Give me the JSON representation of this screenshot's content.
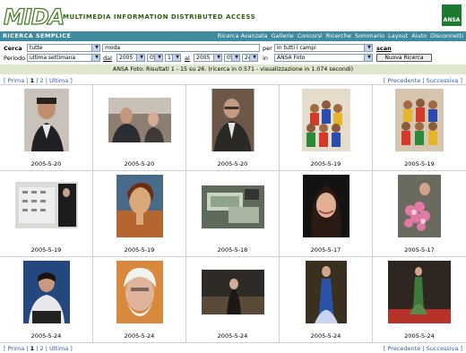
{
  "header": {
    "logo_text": "MIDA",
    "tagline": "MULTIMEDIA INFORMATION DISTRIBUTED ACCESS",
    "brand_badge": "ANSA"
  },
  "nav": {
    "title": "RICERCA SEMPLICE",
    "links": [
      "Ricerca Avanzata",
      "Gallerie",
      "Concorsi",
      "Ricerche",
      "Sommario",
      "Layout",
      "Aiuto",
      "Disconnetti"
    ]
  },
  "form": {
    "cerca_label": "Cerca",
    "periodo_label": "Periodo",
    "mode_select": "tutte",
    "query_value": "moda",
    "per_label": "per",
    "field_select": "In tutti i campi",
    "scan_link": "scan",
    "period_select": "ultima settimana",
    "dal_label": "dal",
    "from_year": "2005",
    "from_month": "05",
    "from_day": "17",
    "al_label": "al",
    "to_year": "2005",
    "to_month": "05",
    "to_day": "24",
    "in_label": "in",
    "archive_select": "ANSA Foto",
    "new_search_button": "Nuova Ricerca"
  },
  "result_text": "ANSA Foto: Risultati 1 - 15 su 26. (ricerca in 0.571 - visualizzazione in 1.074 secondi)",
  "pager": {
    "open": "[",
    "first": "Prima",
    "sep": "|",
    "page1": "1",
    "page2": "2",
    "last": "Ultima",
    "close": "]",
    "prev": "Precedente",
    "next": "Successiva"
  },
  "photos": [
    {
      "date": "2005-5-20",
      "bg": "#c8b5a6"
    },
    {
      "date": "2005-5-20",
      "bg": "#6d5a4c"
    },
    {
      "date": "2005-5-20",
      "bg": "#5a4a3e"
    },
    {
      "date": "2005-5-19",
      "bg": "#d9a46a"
    },
    {
      "date": "2005-5-19",
      "bg": "#c47a4d"
    },
    {
      "date": "2005-5-19",
      "bg": "#d6d3cf"
    },
    {
      "date": "2005-5-19",
      "bg": "#9a7a52"
    },
    {
      "date": "2005-5-18",
      "bg": "#7e8a78"
    },
    {
      "date": "2005-5-17",
      "bg": "#1e1a1a"
    },
    {
      "date": "2005-5-17",
      "bg": "#b8879a"
    },
    {
      "date": "2005-5-24",
      "bg": "#2a4a80"
    },
    {
      "date": "2005-5-24",
      "bg": "#c98a5c"
    },
    {
      "date": "2005-5-24",
      "bg": "#3b3430"
    },
    {
      "date": "2005-5-24",
      "bg": "#2e3a62"
    },
    {
      "date": "2005-5-24",
      "bg": "#4a3a2e"
    }
  ]
}
